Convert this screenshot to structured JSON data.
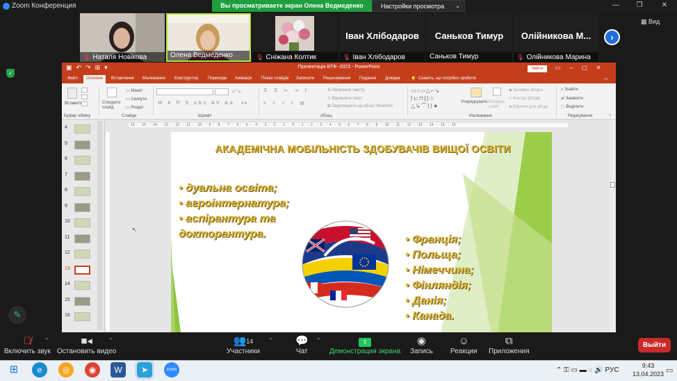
{
  "zoom": {
    "title": "Zoom Конференция",
    "share_banner": "Вы просматриваете экран Олена Ведмеденко",
    "view_options": "Настройки просмотра",
    "view_label": "Вид",
    "participants_tiles": [
      {
        "name": "Наталя Новікова",
        "muted": true,
        "big_name": ""
      },
      {
        "name": "Олена Ведмеденко",
        "muted": false,
        "big_name": ""
      },
      {
        "name": "Сніжана Колтик",
        "muted": true,
        "big_name": ""
      },
      {
        "name": "Іван Хлібодаров",
        "muted": true,
        "big_name": "Іван Хлібодаров"
      },
      {
        "name": "Саньков Тимур",
        "muted": false,
        "big_name": "Саньков Тимур"
      },
      {
        "name": "Олійникова Марина",
        "muted": true,
        "big_name": "Олійникова  М..."
      }
    ],
    "bottom": {
      "mute": "Включить звук",
      "video": "Остановить видео",
      "participants": "Участники",
      "participants_count": "14",
      "chat": "Чат",
      "share": "Демонстрация экрана",
      "record": "Запись",
      "reactions": "Реакции",
      "apps": "Приложения",
      "exit": "Выйти"
    }
  },
  "powerpoint": {
    "window_title": "Презентація БТФ -2023  -  PowerPoint",
    "login": "Увійти",
    "menu": [
      "Файл",
      "Основне",
      "Вставлення",
      "Малювання",
      "Конструктор",
      "Переходи",
      "Анімація",
      "Показ слайдів",
      "Записати",
      "Рецензування",
      "Подання",
      "Довідка"
    ],
    "tell_me": "Скажіть, що потрібно зробити",
    "ribbon": {
      "paste": "Вставити",
      "clipboard": "Буфер обміну",
      "new_slide": "Створити слайд",
      "layout": "Макет",
      "reset": "Скинути",
      "section": "Розділ",
      "slides": "Слайди",
      "font": "Шрифт",
      "text_direction": "Напрямок тексту",
      "align_text": "Вирівняти текст",
      "smartart": "Перетворити на об'єкт SmartArt",
      "paragraph": "Абзац",
      "arrange": "Упорядкувати",
      "quick_styles": "Експрес-стилі",
      "shape_fill": "Заливка фігури",
      "shape_outline": "Контур фігури",
      "shape_effects": "Ефекти для фігур",
      "drawing": "Малювання",
      "find": "Знайти",
      "replace": "Замінити",
      "select": "Виділити",
      "editing": "Редагування"
    },
    "slide_numbers": [
      "4",
      "5",
      "6",
      "7",
      "8",
      "9",
      "10",
      "11",
      "12",
      "13",
      "14",
      "15",
      "16"
    ],
    "current_slide": "13",
    "ruler": "· 16 · · · 15 · · · 14 · · · 13 · · · 12 · · · 11 · · · 10 · · · 9 · · · 8 · · · 7 · · · 6 · · · 5 · · · 4 · · · 3 · · · 2 · · · 1 · · · 0 · · · 1 · · · 2 · · · 3 · · · 4 · · · 5 · · · 6 · · · 7 · · · 8 · · · 9 · · · 10 · · · 11 · · · 12 · · · 13 · · · 14 · · · 15 · · · 16 ·",
    "slide": {
      "title": "АКАДЕМІЧНА МОБІЛЬНІСТЬ ЗДОБУВАЧІВ ВИЩОЇ ОСВІТИ",
      "left_bullets": [
        "• дуальна освіта;",
        "• агроінтернатура;",
        "• аспірантура та",
        "докторантура."
      ],
      "right_bullets": [
        "• Франція;",
        "• Польща;",
        "• Німеччина;",
        "• Фінляндія;",
        "• Данія;",
        "• Канада."
      ]
    }
  },
  "taskbar": {
    "lang": "РУС",
    "time": "9:43",
    "date": "13.04.2023"
  },
  "colors": {
    "ppt_red": "#c43e1c",
    "zoom_green": "#1e9e3f",
    "slide_gold": "#dcb93b",
    "slide_green": "#8cc63f"
  }
}
